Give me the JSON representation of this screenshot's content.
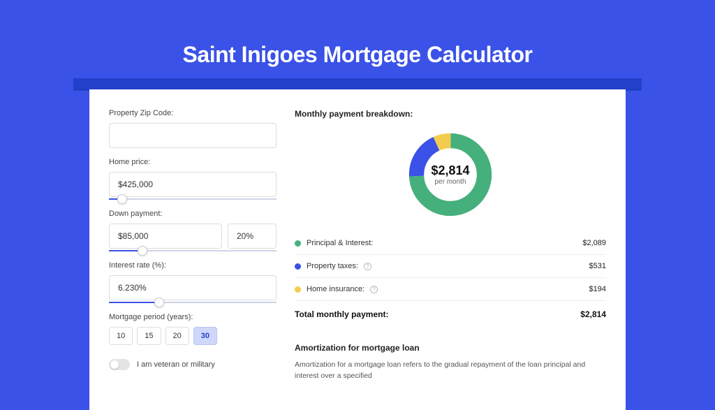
{
  "title": "Saint Inigoes Mortgage Calculator",
  "form": {
    "zip_label": "Property Zip Code:",
    "zip_value": "",
    "home_price_label": "Home price:",
    "home_price_value": "$425,000",
    "home_price_slider_pct": 8,
    "down_payment_label": "Down payment:",
    "down_payment_value": "$85,000",
    "down_payment_pct_value": "20%",
    "down_payment_slider_pct": 20,
    "interest_label": "Interest rate (%):",
    "interest_value": "6.230%",
    "interest_slider_pct": 30,
    "period_label": "Mortgage period (years):",
    "period_options": [
      "10",
      "15",
      "20",
      "30"
    ],
    "period_active": "30",
    "veteran_label": "I am veteran or military"
  },
  "breakdown": {
    "title": "Monthly payment breakdown:",
    "center_amount": "$2,814",
    "center_sub": "per month",
    "items": [
      {
        "label": "Principal & Interest:",
        "value": "$2,089",
        "color": "#45b07c",
        "has_info": false
      },
      {
        "label": "Property taxes:",
        "value": "$531",
        "color": "#3a52e8",
        "has_info": true
      },
      {
        "label": "Home insurance:",
        "value": "$194",
        "color": "#f3cc4d",
        "has_info": true
      }
    ],
    "total_label": "Total monthly payment:",
    "total_value": "$2,814"
  },
  "chart_data": {
    "type": "pie",
    "title": "Monthly payment breakdown",
    "series": [
      {
        "name": "Principal & Interest",
        "value": 2089,
        "color": "#45b07c"
      },
      {
        "name": "Property taxes",
        "value": 531,
        "color": "#3a52e8"
      },
      {
        "name": "Home insurance",
        "value": 194,
        "color": "#f3cc4d"
      }
    ],
    "total": 2814,
    "center_label": "$2,814 per month"
  },
  "amortization": {
    "title": "Amortization for mortgage loan",
    "text": "Amortization for a mortgage loan refers to the gradual repayment of the loan principal and interest over a specified"
  }
}
